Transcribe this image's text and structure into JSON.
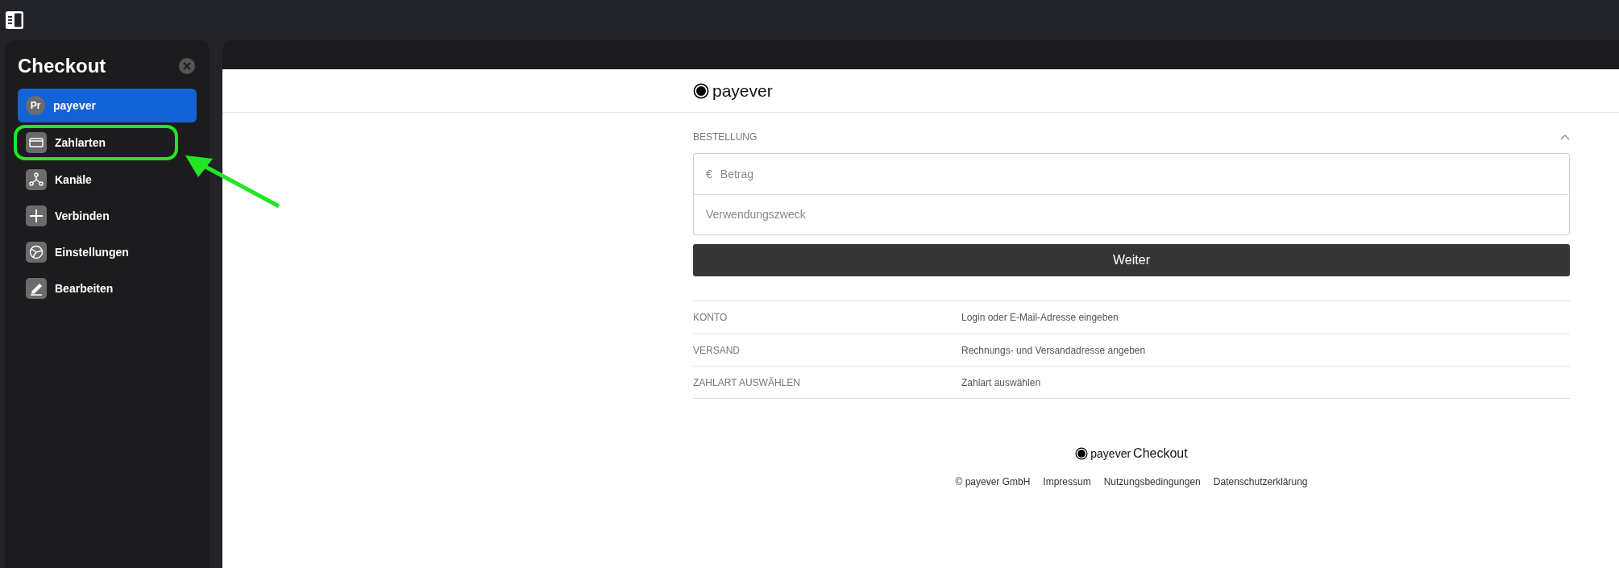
{
  "sidebar": {
    "title": "Checkout",
    "items": [
      {
        "label": "payever",
        "avatar": "Pr",
        "selected": true,
        "highlighted": false
      },
      {
        "label": "Zahlarten",
        "selected": false,
        "highlighted": true
      },
      {
        "label": "Kanäle",
        "selected": false,
        "highlighted": false
      },
      {
        "label": "Verbinden",
        "selected": false,
        "highlighted": false
      },
      {
        "label": "Einstellungen",
        "selected": false,
        "highlighted": false
      },
      {
        "label": "Bearbeiten",
        "selected": false,
        "highlighted": false
      }
    ]
  },
  "checkout": {
    "logo": "payever",
    "order": {
      "title": "BESTELLUNG",
      "expanded": true,
      "fields": [
        {
          "prefix": "€",
          "placeholder": "Betrag"
        },
        {
          "placeholder": "Verwendungszweck"
        }
      ],
      "button": "Weiter"
    },
    "steps": [
      {
        "label": "KONTO",
        "value": "Login oder E-Mail-Adresse eingeben"
      },
      {
        "label": "VERSAND",
        "value": "Rechnungs- und Versandadresse angeben"
      },
      {
        "label": "ZAHLART AUSWÄHLEN",
        "value": "Zahlart auswählen"
      }
    ],
    "footer": {
      "logo": "payever",
      "product": "Checkout",
      "links": [
        "© payever GmbH",
        "Impressum",
        "Nutzungsbedingungen",
        "Datenschutzerklärung"
      ]
    }
  }
}
